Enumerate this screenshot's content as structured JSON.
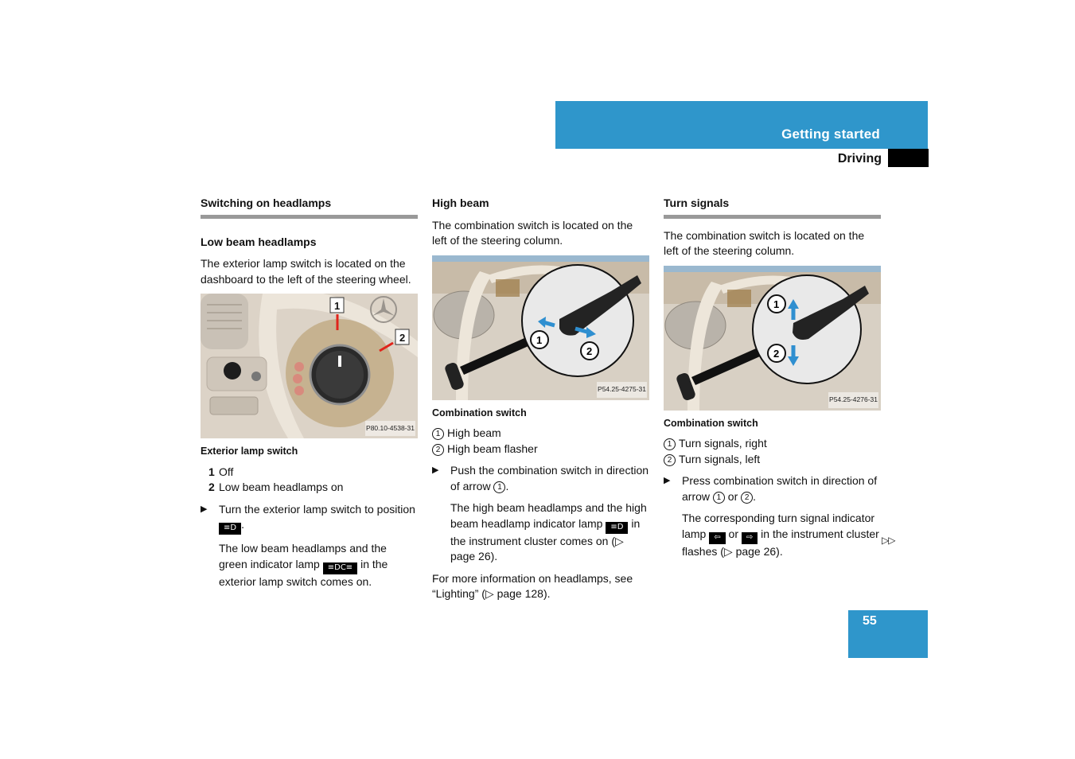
{
  "header": {
    "section_title": "Getting started",
    "subsection_title": "Driving"
  },
  "col1": {
    "heading": "Switching on headlamps",
    "subheading": "Low beam headlamps",
    "intro": "The exterior lamp switch is located on the dashboard to the left of the steering wheel.",
    "figure": {
      "code": "P80.10-4538-31",
      "callouts": [
        "1",
        "2"
      ],
      "caption": "Exterior lamp switch"
    },
    "legend": [
      {
        "num": "1",
        "text": "Off"
      },
      {
        "num": "2",
        "text": "Low beam headlamps on"
      }
    ],
    "step_prefix": "Turn the exterior lamp switch to position",
    "step_icon": "low-beam-symbol",
    "step_icon_glyph": "≡D",
    "step_suffix": ".",
    "result_prefix": "The low beam headlamps and the green indicator lamp",
    "result_icon": "parking-lamp-symbol",
    "result_icon_glyph": "≡DC≡",
    "result_suffix": "in the exterior lamp switch comes on."
  },
  "col2": {
    "heading": "High beam",
    "intro": "The combination switch is located on the left of the steering column.",
    "figure": {
      "code": "P54.25-4275-31",
      "callouts": [
        "1",
        "2"
      ],
      "caption": "Combination switch"
    },
    "legend": [
      {
        "num": "1",
        "text": "High beam"
      },
      {
        "num": "2",
        "text": "High beam flasher"
      }
    ],
    "step_prefix": "Push the combination switch in direction of arrow",
    "step_ref": "1",
    "step_suffix": ".",
    "result_prefix": "The high beam headlamps and the high beam headlamp indicator lamp",
    "result_icon": "high-beam-symbol",
    "result_icon_glyph": "≡D",
    "result_suffix": "in the instrument cluster comes on",
    "result_ref": "(▷ page 26).",
    "more_info": "For more information on headlamps, see “Lighting” (▷ page 128)."
  },
  "col3": {
    "heading": "Turn signals",
    "intro": "The combination switch is located on the left of the steering column.",
    "figure": {
      "code": "P54.25-4276-31",
      "callouts": [
        "1",
        "2"
      ],
      "caption": "Combination switch"
    },
    "legend": [
      {
        "num": "1",
        "text": "Turn signals, right"
      },
      {
        "num": "2",
        "text": "Turn signals, left"
      }
    ],
    "step_prefix": "Press combination switch in direction of arrow",
    "step_ref1": "1",
    "step_mid": "or",
    "step_ref2": "2",
    "step_suffix": ".",
    "result_prefix": "The corresponding turn signal indicator lamp",
    "result_icon_left": "left-turn-arrow",
    "result_icon_left_glyph": "⇦",
    "result_or": "or",
    "result_icon_right": "right-turn-arrow",
    "result_icon_right_glyph": "⇨",
    "result_suffix": "in the instrument cluster flashes (▷ page 26)."
  },
  "footer": {
    "page_number": "55",
    "continued_marker": "▷▷"
  }
}
